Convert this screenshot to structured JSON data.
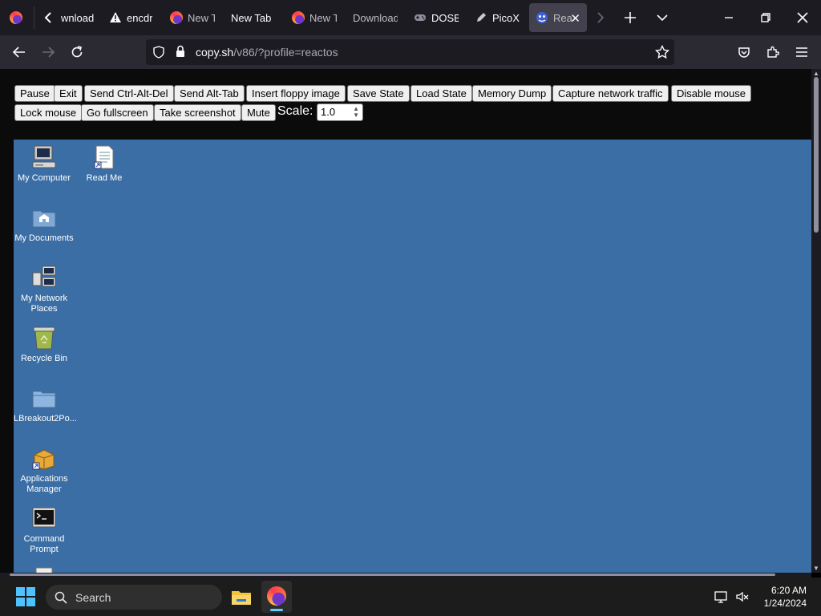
{
  "browser": {
    "tabs": [
      {
        "label": "wnload",
        "icon": "chevron-left-icon"
      },
      {
        "label": "encdr",
        "icon": "warning-icon"
      },
      {
        "label": "New T",
        "icon": "firefox-icon"
      },
      {
        "label": "New Tab",
        "icon": ""
      },
      {
        "label": "New T",
        "icon": "firefox-icon"
      },
      {
        "label": "Download",
        "icon": ""
      },
      {
        "label": "DOSB",
        "icon": "gamepad-icon"
      },
      {
        "label": "PicoX",
        "icon": "pen-icon"
      },
      {
        "label": "Rea",
        "icon": "reactos-icon",
        "active": true
      }
    ],
    "url_host": "copy.sh",
    "url_path": "/v86/?profile=reactos"
  },
  "controls": {
    "buttons": [
      "Pause",
      "Exit",
      "Send Ctrl-Alt-Del",
      "Send Alt-Tab",
      "Insert floppy image",
      "Save State",
      "Load State",
      "Memory Dump",
      "Capture network traffic",
      "Disable mouse",
      "Lock mouse",
      "Go fullscreen",
      "Take screenshot",
      "Mute"
    ],
    "scale_label": "Scale:",
    "scale_value": "1.0"
  },
  "desktop": {
    "icons": [
      {
        "label": "My Computer",
        "icon": "my-computer-icon"
      },
      {
        "label": "Read Me",
        "icon": "readme-icon"
      },
      {
        "label": "My Documents",
        "icon": "my-documents-icon"
      },
      {
        "label": "My Network Places",
        "icon": "network-places-icon"
      },
      {
        "label": "Recycle Bin",
        "icon": "recycle-bin-icon"
      },
      {
        "label": "LBreakout2Po...",
        "icon": "folder-icon"
      },
      {
        "label": "Applications Manager",
        "icon": "applications-manager-icon"
      },
      {
        "label": "Command Prompt",
        "icon": "command-prompt-icon"
      }
    ]
  },
  "taskbar": {
    "search_label": "Search",
    "time": "6:20 AM",
    "date": "1/24/2024"
  },
  "colors": {
    "desktop_bg": "#3a6ea5",
    "browser_bg": "#1c1b22",
    "taskbar_bg": "#1c1c1c"
  }
}
